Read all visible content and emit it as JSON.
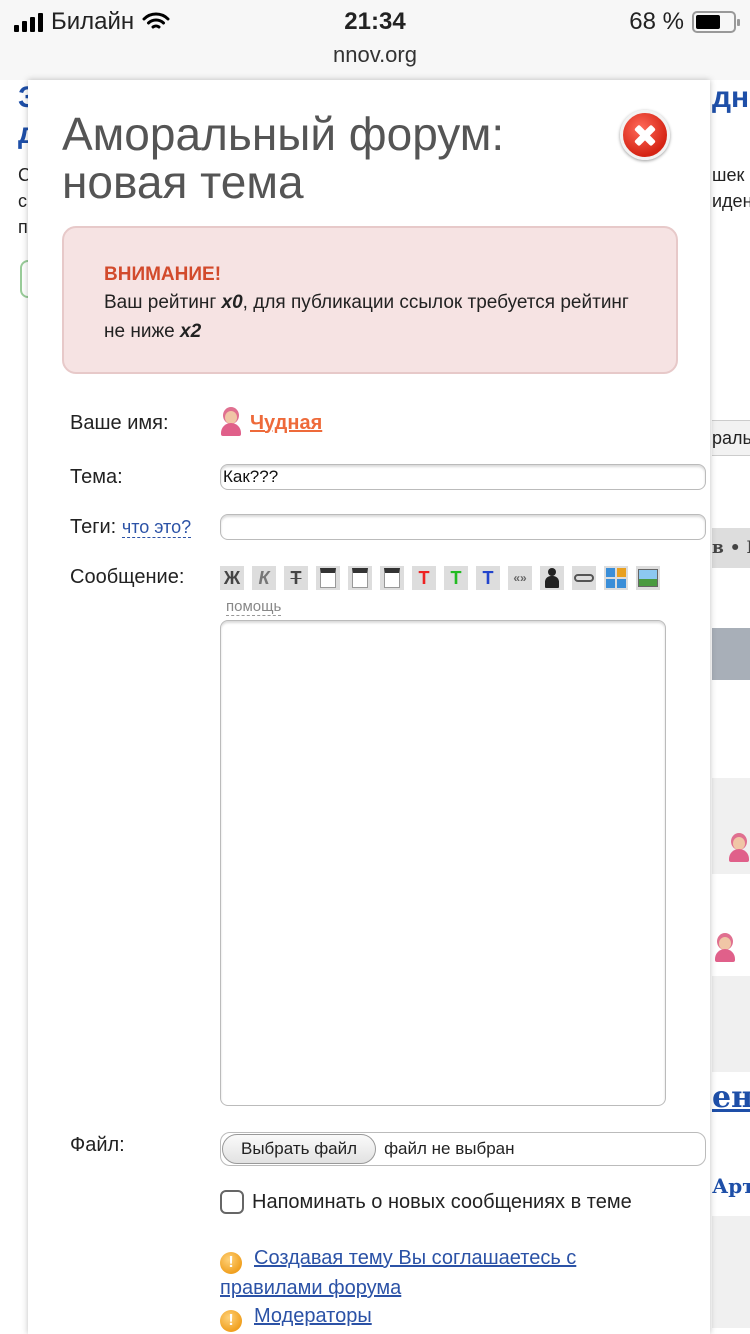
{
  "status_bar": {
    "carrier": "Билайн",
    "time": "21:34",
    "url": "nnov.org",
    "battery_label": "68 %",
    "battery_level": 0.68
  },
  "background": {
    "heading_left": "З\nд",
    "heading_right": "дны",
    "text_left": "С\nс\nп",
    "text_right": "шек\nиден",
    "strip_1": "раль",
    "strip_2": "в • К",
    "link_1": "ен",
    "link_2": "Арт"
  },
  "modal": {
    "title": "Аморальный форум: новая тема",
    "warning": {
      "title": "ВНИМАНИЕ!",
      "text_1": "Ваш рейтинг ",
      "rating": "x0",
      "text_2": ", для публикации ссылок требуется рейтинг не ниже ",
      "required": "x2"
    },
    "form": {
      "name_label": "Ваше имя:",
      "user_name": "Чудная",
      "topic_label": "Тема:",
      "topic_value": "Как???",
      "tags_label": "Теги:",
      "tags_help": "что это?",
      "tags_value": "",
      "message_label": "Сообщение:",
      "toolbar": {
        "bold": "Ж",
        "italic": "К",
        "strike": "Т",
        "color_red": "Т",
        "color_green": "Т",
        "color_blue": "Т",
        "quote": "«»"
      },
      "help": "помощь",
      "file_label": "Файл:",
      "file_button": "Выбрать файл",
      "file_status": "файл не выбран",
      "notify_label": "Напоминать о новых сообщениях в теме"
    },
    "links": {
      "rules_1": "Создавая тему Вы соглашаетесь с",
      "rules_2": "правилами форума",
      "moderators": "Модераторы"
    }
  }
}
